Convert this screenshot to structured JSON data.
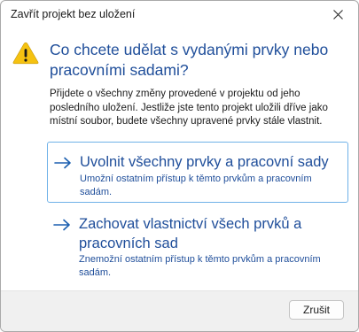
{
  "window": {
    "title": "Zavřít projekt bez uložení",
    "close_icon": "close-icon"
  },
  "content": {
    "warning_icon": "warning-icon",
    "heading": "Co chcete udělat s vydanými prvky nebo pracovními sadami?",
    "description": "Přijdete o všechny změny provedené v projektu od jeho posledního uložení. Jestliže jste tento projekt uložili dříve jako místní soubor, budete všechny upravené prvky stále vlastnit."
  },
  "commands": [
    {
      "title": "Uvolnit všechny prvky a pracovní sady",
      "subtitle": "Umožní ostatním přístup k těmto prvkům a pracovním sadám.",
      "icon": "arrow-right-icon"
    },
    {
      "title": "Zachovat vlastnictví všech prvků a pracovních sad",
      "subtitle": "Znemožní ostatním přístup k těmto prvkům a pracovním sadám.",
      "icon": "arrow-right-icon"
    }
  ],
  "footer": {
    "cancel_label": "Zrušit"
  },
  "colors": {
    "accent_text": "#1f4e9a",
    "arrow": "#1b5fb0",
    "focus_border": "#6fb1e8",
    "warning_fill": "#f5c211"
  }
}
